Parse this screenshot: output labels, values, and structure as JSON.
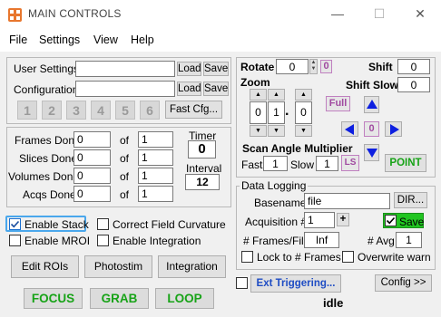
{
  "window": {
    "title": "MAIN CONTROLS",
    "minimize": "—",
    "maximize": "☐",
    "close": "✕"
  },
  "menu": [
    "File",
    "Settings",
    "View",
    "Help"
  ],
  "settings_panel": {
    "user_settings_label": "User Settings",
    "user_settings_value": "",
    "configuration_label": "Configuration",
    "configuration_value": "",
    "load_label": "Load",
    "save_label": "Save",
    "fast_cfg_label": "Fast Cfg...",
    "slots": [
      "1",
      "2",
      "3",
      "4",
      "5",
      "6"
    ]
  },
  "counters": {
    "frames_done_label": "Frames Done",
    "slices_done_label": "Slices Done",
    "volumes_done_label": "Volumes Done",
    "acqs_done_label": "Acqs Done",
    "of_label": "of",
    "frames_done": "0",
    "frames_total": "1",
    "slices_done": "0",
    "slices_total": "1",
    "volumes_done": "0",
    "volumes_total": "1",
    "acqs_done": "0",
    "acqs_total": "1",
    "timer_label": "Timer",
    "timer_value": "0",
    "interval_label": "Interval",
    "interval_value": "12"
  },
  "options": {
    "enable_stack": "Enable Stack",
    "enable_stack_checked": true,
    "correct_field_curvature": "Correct Field Curvature",
    "correct_field_curvature_checked": false,
    "enable_mroi": "Enable MROI",
    "enable_mroi_checked": false,
    "enable_integration": "Enable Integration",
    "enable_integration_checked": false,
    "edit_rois": "Edit ROIs",
    "photostim": "Photostim",
    "integration": "Integration"
  },
  "actions": {
    "focus": "FOCUS",
    "grab": "GRAB",
    "loop": "LOOP",
    "color": "#17a317"
  },
  "scan": {
    "rotate_label": "Rotate",
    "rotate_value": "0",
    "rotate_reset": "0",
    "shift_label": "Shift",
    "shift_value": "0",
    "shift_slow_label": "Shift Slow",
    "shift_slow_value": "0",
    "zoom_label": "Zoom",
    "zoom_digit1": "0",
    "zoom_digit2": "1",
    "zoom_point": ".",
    "zoom_digit3": "0",
    "full_label": "Full",
    "center_value": "0",
    "scan_angle_label": "Scan Angle Multiplier",
    "fast_label": "Fast",
    "fast_value": "1",
    "slow_label": "Slow",
    "slow_value": "1",
    "ls_label": "LS",
    "point_label": "POINT"
  },
  "data_logging": {
    "title": "Data Logging",
    "basename_label": "Basename",
    "basename_value": "file",
    "dir_label": "DIR...",
    "acquisition_label": "Acquisition #",
    "acquisition_value": "1",
    "plus_label": "+",
    "save_label": "Save",
    "save_checked": true,
    "frames_file_label": "# Frames/File",
    "frames_file_value": "Inf",
    "avg_label": "# Avg",
    "avg_value": "1",
    "lock_label": "Lock to # Frames",
    "lock_checked": false,
    "overwrite_label": "Overwrite warn",
    "overwrite_checked": false
  },
  "footer": {
    "ext_triggering": "Ext Triggering...",
    "status": "idle",
    "config": "Config >>"
  }
}
